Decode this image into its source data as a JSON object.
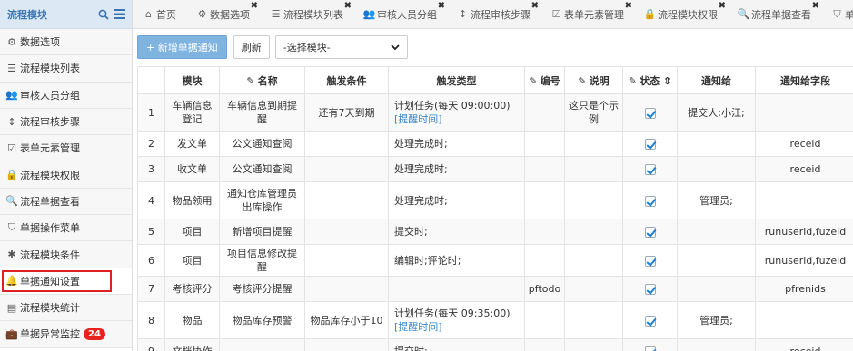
{
  "sidebar": {
    "title": "流程模块",
    "items": [
      {
        "label": "数据选项",
        "icon": "gear-icon",
        "glyph": "⚙"
      },
      {
        "label": "流程模块列表",
        "icon": "list-icon",
        "glyph": "☰"
      },
      {
        "label": "审核人员分组",
        "icon": "users-icon",
        "glyph": "👥"
      },
      {
        "label": "流程审核步骤",
        "icon": "steps-icon",
        "glyph": "↕"
      },
      {
        "label": "表单元素管理",
        "icon": "check-square-icon",
        "glyph": "☑"
      },
      {
        "label": "流程模块权限",
        "icon": "lock-icon",
        "glyph": "🔒"
      },
      {
        "label": "流程单据查看",
        "icon": "search-icon",
        "glyph": "🔍"
      },
      {
        "label": "单据操作菜单",
        "icon": "bookmark-icon",
        "glyph": "⛉"
      },
      {
        "label": "流程模块条件",
        "icon": "asterisk-icon",
        "glyph": "✱"
      },
      {
        "label": "单据通知设置",
        "icon": "bell-icon",
        "glyph": "🔔"
      },
      {
        "label": "流程模块统计",
        "icon": "chart-icon",
        "glyph": "▤"
      },
      {
        "label": "单据异常监控",
        "icon": "briefcase-icon",
        "glyph": "💼",
        "badge": "24"
      }
    ]
  },
  "tabs": [
    {
      "label": "首页",
      "icon": "home-icon",
      "glyph": "⌂",
      "closable": false
    },
    {
      "label": "数据选项",
      "icon": "gear-icon",
      "glyph": "⚙",
      "closable": true
    },
    {
      "label": "流程模块列表",
      "icon": "list-icon",
      "glyph": "☰",
      "closable": true
    },
    {
      "label": "审核人员分组",
      "icon": "users-icon",
      "glyph": "👥",
      "closable": true
    },
    {
      "label": "流程审核步骤",
      "icon": "steps-icon",
      "glyph": "↕",
      "closable": true
    },
    {
      "label": "表单元素管理",
      "icon": "check-square-icon",
      "glyph": "☑",
      "closable": true
    },
    {
      "label": "流程模块权限",
      "icon": "lock-icon",
      "glyph": "🔒",
      "closable": true
    },
    {
      "label": "流程单据查看",
      "icon": "search-icon",
      "glyph": "🔍",
      "closable": true
    },
    {
      "label": "单据",
      "icon": "bookmark-icon",
      "glyph": "⛉",
      "closable": false
    }
  ],
  "toolbar": {
    "add_label": "+ 新增单据通知",
    "refresh_label": "刷新",
    "select_value": "-选择模块-"
  },
  "table": {
    "headers": [
      "",
      "模块",
      "名称",
      "触发条件",
      "触发类型",
      "编号",
      "说明",
      "状态",
      "通知给",
      "通知给字段"
    ],
    "rows": [
      {
        "no": "1",
        "module": "车辆信息登记",
        "name": "车辆信息到期提醒",
        "cond": "还有7天到期",
        "type": "计划任务(每天 09:00:00)",
        "type_link": "[提醒时间]",
        "code": "",
        "desc": "这只是个示例",
        "status": true,
        "notify": "提交人;小江;",
        "field": ""
      },
      {
        "no": "2",
        "module": "发文单",
        "name": "公文通知查阅",
        "cond": "",
        "type": "处理完成时;",
        "type_link": "",
        "code": "",
        "desc": "",
        "status": true,
        "notify": "",
        "field": "receid"
      },
      {
        "no": "3",
        "module": "收文单",
        "name": "公文通知查阅",
        "cond": "",
        "type": "处理完成时;",
        "type_link": "",
        "code": "",
        "desc": "",
        "status": true,
        "notify": "",
        "field": "receid"
      },
      {
        "no": "4",
        "module": "物品领用",
        "name": "通知仓库管理员出库操作",
        "cond": "",
        "type": "处理完成时;",
        "type_link": "",
        "code": "",
        "desc": "",
        "status": true,
        "notify": "管理员;",
        "field": ""
      },
      {
        "no": "5",
        "module": "项目",
        "name": "新增项目提醒",
        "cond": "",
        "type": "提交时;",
        "type_link": "",
        "code": "",
        "desc": "",
        "status": true,
        "notify": "",
        "field": "runuserid,fuzeid"
      },
      {
        "no": "6",
        "module": "项目",
        "name": "项目信息修改提醒",
        "cond": "",
        "type": "编辑时;评论时;",
        "type_link": "",
        "code": "",
        "desc": "",
        "status": true,
        "notify": "",
        "field": "runuserid,fuzeid"
      },
      {
        "no": "7",
        "module": "考核评分",
        "name": "考核评分提醒",
        "cond": "",
        "type": "",
        "type_link": "",
        "code": "pftodo",
        "desc": "",
        "status": true,
        "notify": "",
        "field": "pfrenids"
      },
      {
        "no": "8",
        "module": "物品",
        "name": "物品库存预警",
        "cond": "物品库存小于10",
        "type": "计划任务(每天 09:35:00)",
        "type_link": "[提醒时间]",
        "code": "",
        "desc": "",
        "status": true,
        "notify": "管理员;",
        "field": ""
      },
      {
        "no": "9",
        "module": "文档协作",
        "name": "",
        "cond": "",
        "type": "提交时;",
        "type_link": "",
        "code": "",
        "desc": "",
        "status": true,
        "notify": "",
        "field": "receid"
      }
    ]
  }
}
